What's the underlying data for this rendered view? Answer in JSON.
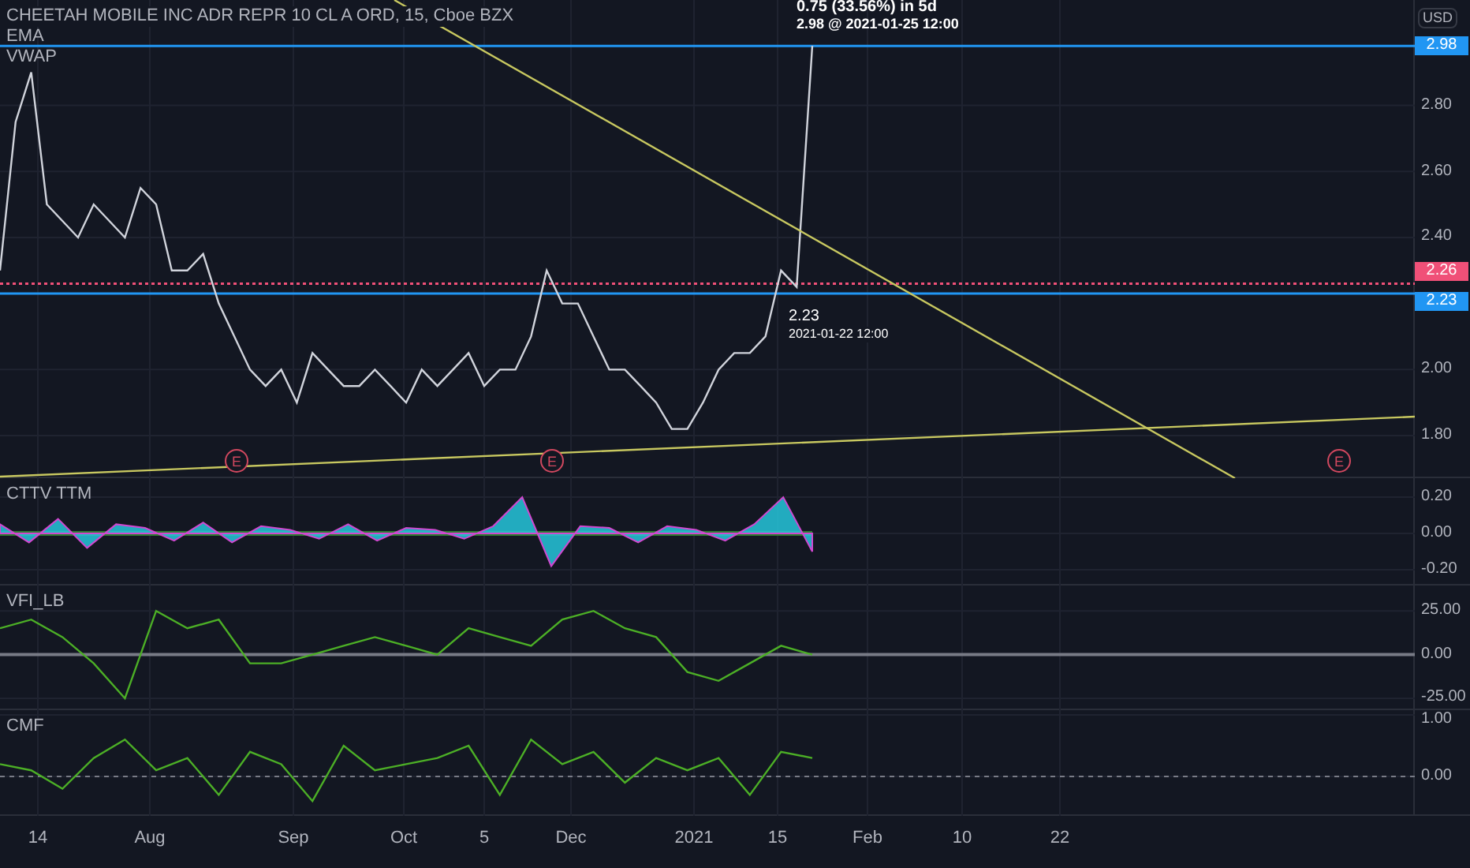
{
  "legend": {
    "symbol": "CHEETAH MOBILE INC ADR REPR 10 CL A ORD, 15, Cboe BZX",
    "indicators": [
      "EMA",
      "VWAP"
    ]
  },
  "currency": "USD",
  "measure": {
    "change": "0.75 (33.56%) in 5d",
    "target": "2.98 @ 2021-01-25  12:00"
  },
  "marker": {
    "price": "2.23",
    "time": "2021-01-22 12:00"
  },
  "time_axis": [
    "14",
    "Aug",
    "Sep",
    "Oct",
    "5",
    "Dec",
    "2021",
    "15",
    "Feb",
    "10",
    "22"
  ],
  "earnings": [
    "E",
    "E",
    "E"
  ],
  "chart_data": {
    "type": "line",
    "grid": true,
    "ylim": [
      1.671,
      3.119
    ],
    "ref_lines": [
      {
        "axis": "y",
        "value": 2.98,
        "label": "2.98",
        "color": "#2196f3"
      },
      {
        "axis": "y",
        "value": 2.26,
        "label": "2.26",
        "color": "#f05078"
      },
      {
        "axis": "y",
        "value": 2.23,
        "label": "2.23",
        "color": "#2196f3"
      }
    ],
    "yticks": [
      {
        "value": 1.8,
        "label": "1.80"
      },
      {
        "value": 2.0,
        "label": "2.00"
      },
      {
        "value": 2.4,
        "label": "2.40"
      },
      {
        "value": 2.6,
        "label": "2.60"
      },
      {
        "value": 2.8,
        "label": "2.80"
      }
    ],
    "categories": [
      null,
      null,
      null,
      null,
      null,
      null,
      null,
      null,
      null,
      null,
      null,
      null,
      null,
      null,
      null,
      null,
      null,
      null,
      null,
      null,
      null,
      null,
      null,
      null,
      null,
      null,
      null,
      null,
      null,
      null,
      null,
      null,
      null,
      null,
      null,
      null,
      null,
      null,
      null,
      null,
      null,
      null,
      null,
      null,
      null,
      null,
      null,
      null,
      null,
      null,
      null,
      null,
      null
    ],
    "series": [
      {
        "color": "#d1d4dc",
        "values": [
          2.3,
          2.75,
          2.9,
          2.5,
          2.45,
          2.4,
          2.5,
          2.45,
          2.4,
          2.55,
          2.5,
          2.3,
          2.3,
          2.35,
          2.2,
          2.1,
          2.0,
          1.95,
          2.0,
          1.9,
          2.05,
          2.0,
          1.95,
          1.95,
          2.0,
          1.95,
          1.9,
          2.0,
          1.95,
          2.0,
          2.05,
          1.95,
          2.0,
          2.0,
          2.1,
          2.3,
          2.2,
          2.2,
          2.1,
          2.0,
          2.0,
          1.95,
          1.9,
          1.82,
          1.82,
          1.9,
          2.0,
          2.05,
          2.05,
          2.1,
          2.3,
          2.25,
          2.98
        ]
      }
    ]
  },
  "panes": [
    {
      "chart_data": {
        "type": "area",
        "grid": true,
        "ylim": [
          -0.287,
          0.304
        ],
        "ref_lines": [
          {
            "axis": "y",
            "value": 0,
            "color": "#2e7d32"
          }
        ],
        "yticks": [
          {
            "value": 0.2,
            "label": "0.20"
          },
          {
            "value": 0,
            "label": "0.00"
          },
          {
            "value": -0.2,
            "label": "-0.20"
          }
        ],
        "categories": [
          null,
          null,
          null,
          null,
          null,
          null,
          null,
          null,
          null,
          null,
          null,
          null,
          null,
          null,
          null,
          null,
          null,
          null,
          null,
          null,
          null,
          null,
          null,
          null,
          null,
          null,
          null,
          null,
          null
        ],
        "series": [
          {
            "name": "CTTV TTM",
            "color": "#26c6da",
            "values": [
              0.05,
              -0.05,
              0.08,
              -0.08,
              0.05,
              0.03,
              -0.04,
              0.06,
              -0.05,
              0.04,
              0.02,
              -0.03,
              0.05,
              -0.04,
              0.03,
              0.02,
              -0.03,
              0.04,
              0.2,
              -0.18,
              0.04,
              0.03,
              -0.05,
              0.04,
              0.02,
              -0.04,
              0.05,
              0.2,
              -0.1
            ]
          }
        ]
      }
    },
    {
      "chart_data": {
        "type": "line",
        "grid": true,
        "ylim": [
          -31.8,
          39.5
        ],
        "ref_lines": [
          {
            "axis": "y",
            "value": 0,
            "color": "#787b86"
          }
        ],
        "yticks": [
          {
            "value": 25,
            "label": "25.00"
          },
          {
            "value": 0,
            "label": "0.00"
          },
          {
            "value": -25,
            "label": "-25.00"
          }
        ],
        "categories": [
          null,
          null,
          null,
          null,
          null,
          null,
          null,
          null,
          null,
          null,
          null,
          null,
          null,
          null,
          null,
          null,
          null,
          null,
          null,
          null,
          null,
          null,
          null,
          null,
          null,
          null,
          null
        ],
        "series": [
          {
            "name": "VFI_LB",
            "color": "#4caf26",
            "values": [
              15,
              20,
              10,
              -5,
              -25,
              25,
              15,
              20,
              -5,
              -5,
              0,
              5,
              10,
              5,
              0,
              15,
              10,
              5,
              20,
              25,
              15,
              10,
              -10,
              -15,
              -5,
              5,
              0
            ]
          }
        ]
      }
    },
    {
      "chart_data": {
        "type": "line",
        "grid": true,
        "ylim": [
          -0.64,
          1.077
        ],
        "ref_lines": [
          {
            "axis": "y",
            "value": 0,
            "color": "#787b86"
          }
        ],
        "yticks": [
          {
            "value": 1,
            "label": "1.00"
          },
          {
            "value": 0,
            "label": "0.00"
          }
        ],
        "categories": [
          null,
          null,
          null,
          null,
          null,
          null,
          null,
          null,
          null,
          null,
          null,
          null,
          null,
          null,
          null,
          null,
          null,
          null,
          null,
          null,
          null,
          null,
          null,
          null,
          null,
          null,
          null
        ],
        "series": [
          {
            "name": "CMF",
            "color": "#4caf26",
            "values": [
              0.2,
              0.1,
              -0.2,
              0.3,
              0.6,
              0.1,
              0.3,
              -0.3,
              0.4,
              0.2,
              -0.4,
              0.5,
              0.1,
              0.2,
              0.3,
              0.5,
              -0.3,
              0.6,
              0.2,
              0.4,
              -0.1,
              0.3,
              0.1,
              0.3,
              -0.3,
              0.4,
              0.3
            ]
          }
        ]
      }
    }
  ]
}
